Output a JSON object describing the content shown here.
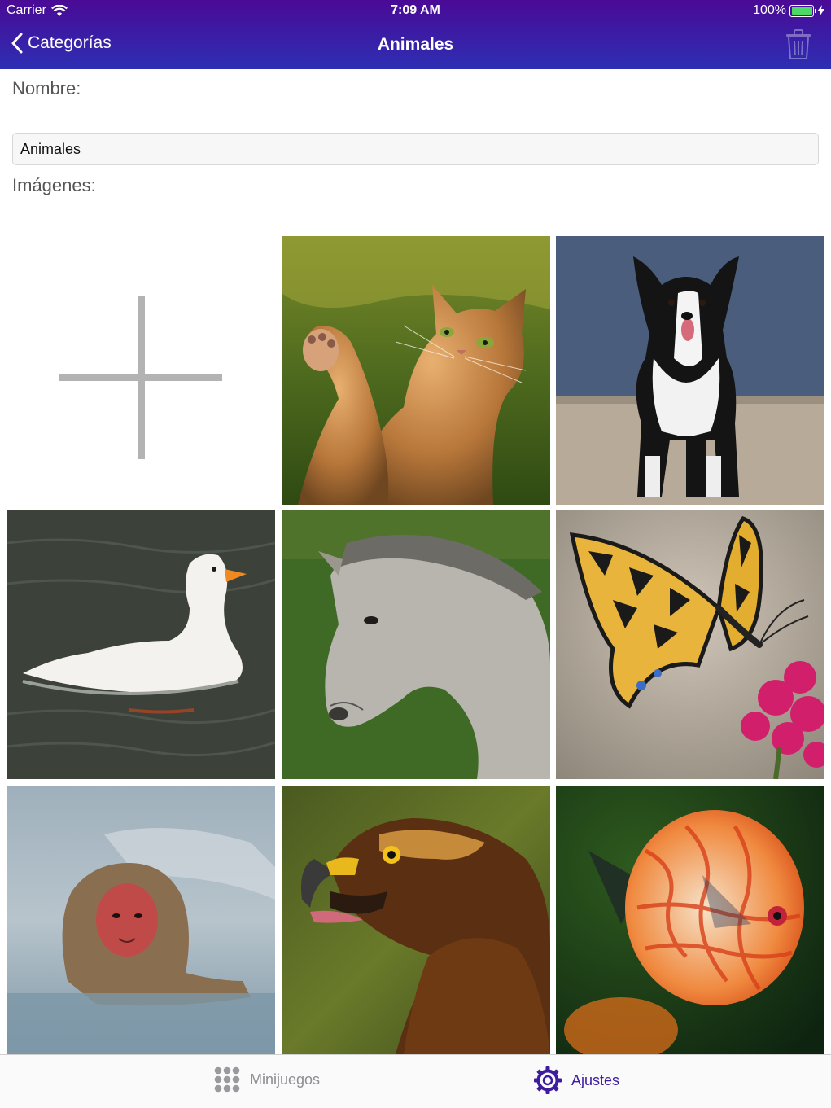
{
  "status_bar": {
    "carrier": "Carrier",
    "time": "7:09 AM",
    "battery": "100%"
  },
  "nav": {
    "back_label": "Categorías",
    "title": "Animales"
  },
  "form": {
    "name_label": "Nombre:",
    "name_value": "Animales",
    "images_label": "Imágenes:"
  },
  "images": [
    {
      "icon": "add-image-icon"
    },
    {
      "subject": "cat"
    },
    {
      "subject": "dog"
    },
    {
      "subject": "duck"
    },
    {
      "subject": "horse"
    },
    {
      "subject": "butterfly"
    },
    {
      "subject": "monkey"
    },
    {
      "subject": "eagle"
    },
    {
      "subject": "fish"
    }
  ],
  "tabbar": {
    "tabs": [
      {
        "label": "Minijuegos",
        "icon": "grid-dots-icon",
        "selected": false
      },
      {
        "label": "Ajustes",
        "icon": "gear-icon",
        "selected": true
      }
    ]
  },
  "colors": {
    "accent": "#3d1c9e",
    "navbar_top": "#4a0a96",
    "navbar_bottom": "#2d2fb4",
    "inactive_tab": "#8e8e93"
  }
}
